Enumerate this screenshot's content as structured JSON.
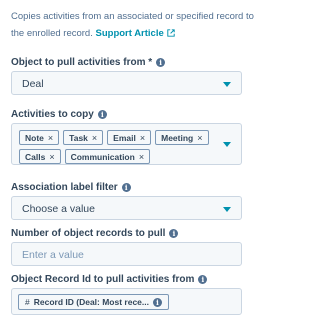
{
  "description": {
    "text": "Copies activities from an associated or specified record to the enrolled record.",
    "link": "Support Article"
  },
  "object_to_pull": {
    "label": "Object to pull activities from *",
    "value": "Deal"
  },
  "activities_to_copy": {
    "label": "Activities to copy",
    "chips_row1": [
      "Note",
      "Task",
      "Email",
      "Meeting"
    ],
    "chips_row2": [
      "Calls",
      "Communication"
    ]
  },
  "association_filter": {
    "label": "Association label filter",
    "placeholder": "Choose a value"
  },
  "num_records": {
    "label": "Number of object records to pull",
    "placeholder": "Enter a value"
  },
  "record_id": {
    "label": "Object Record Id to pull activities from",
    "token": "Record ID (Deal: Most rece..."
  },
  "colors": {
    "link": "#0091ae",
    "text": "#33475b",
    "muted": "#516f90",
    "border": "#cbd6e2",
    "field_bg": "#f5f8fa"
  }
}
